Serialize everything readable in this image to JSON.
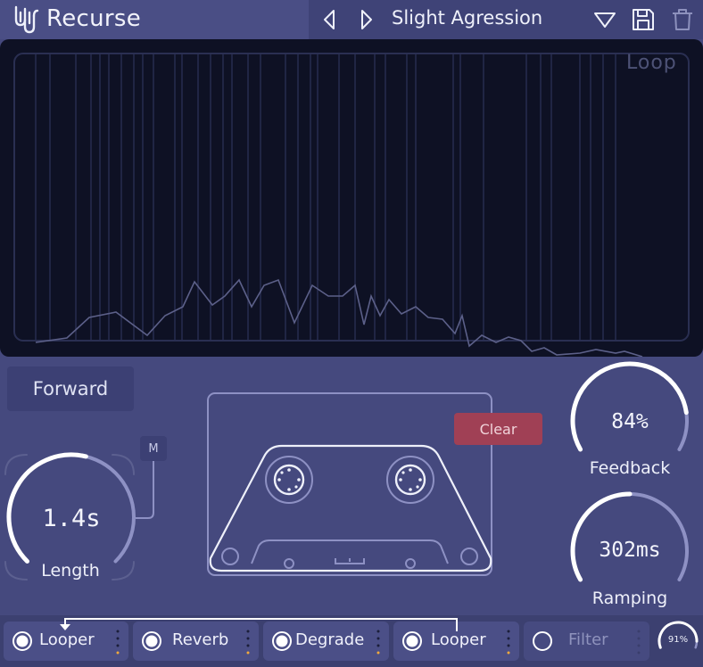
{
  "app": {
    "title": "Recurse"
  },
  "header": {
    "preset_name": "Slight Agression",
    "icons": [
      "prev-preset-icon",
      "next-preset-icon",
      "preset-menu-icon",
      "save-icon",
      "trash-icon"
    ]
  },
  "waveform": {
    "label": "Loop"
  },
  "direction": {
    "label": "Forward"
  },
  "length": {
    "value_text": "1.4s",
    "label": "Length",
    "level": 0.55,
    "mod_button": "M"
  },
  "tape": {
    "clear_label": "Clear"
  },
  "feedback": {
    "value_text": "84%",
    "label": "Feedback",
    "level": 0.84
  },
  "ramping": {
    "value_text": "302ms",
    "label": "Ramping",
    "level": 0.5
  },
  "chain": {
    "slots": [
      {
        "label": "Looper",
        "enabled": true
      },
      {
        "label": "Reverb",
        "enabled": true
      },
      {
        "label": "Degrade",
        "enabled": true
      },
      {
        "label": "Looper",
        "enabled": true
      },
      {
        "label": "Filter",
        "enabled": false
      }
    ],
    "dry_wet": {
      "value_text": "91%",
      "level": 0.91
    }
  },
  "colors": {
    "background": "#45497e",
    "waveform_bg": "#0e1124",
    "accent_red": "#a04055",
    "knob_track": "#8e91c4",
    "knob_fill": "#ffffff",
    "indicator_orange": "#f2a93b"
  }
}
